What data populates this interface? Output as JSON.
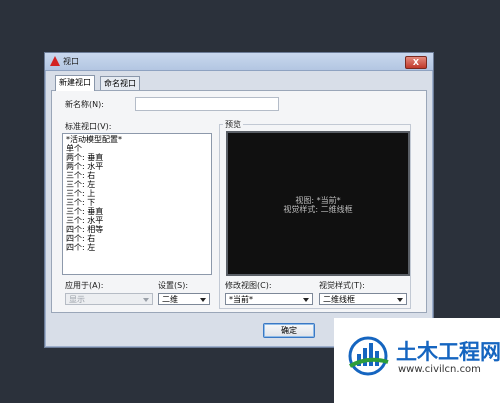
{
  "dialog": {
    "title": "视口",
    "close_label": "X",
    "tabs": [
      {
        "label": "新建视口",
        "active": true
      },
      {
        "label": "命名视口",
        "active": false
      }
    ],
    "new_name_label": "新名称(N):",
    "new_name_value": "",
    "standard_viewports_label": "标准视口(V):",
    "standard_viewports": [
      "*活动模型配置*",
      "单个",
      "两个: 垂直",
      "两个: 水平",
      "三个: 右",
      "三个: 左",
      "三个: 上",
      "三个: 下",
      "三个: 垂直",
      "三个: 水平",
      "四个: 相等",
      "四个: 右",
      "四个: 左"
    ],
    "preview_label": "预览",
    "preview_text": {
      "line1": "视图: *当前*",
      "line2": "视觉样式: 二维线框"
    },
    "apply_to_label": "应用于(A):",
    "apply_to_value": "显示",
    "setup_label": "设置(S):",
    "setup_value": "二维",
    "change_view_label": "修改视图(C):",
    "change_view_value": "*当前*",
    "visual_style_label": "视觉样式(T):",
    "visual_style_value": "二维线框",
    "ok_label": "确定"
  },
  "watermark": {
    "title": "土木工程网",
    "url": "www.civilcn.com"
  },
  "colors": {
    "desktop": "#2b313b",
    "accent_red": "#d32222",
    "watermark_blue": "#1565c0"
  }
}
